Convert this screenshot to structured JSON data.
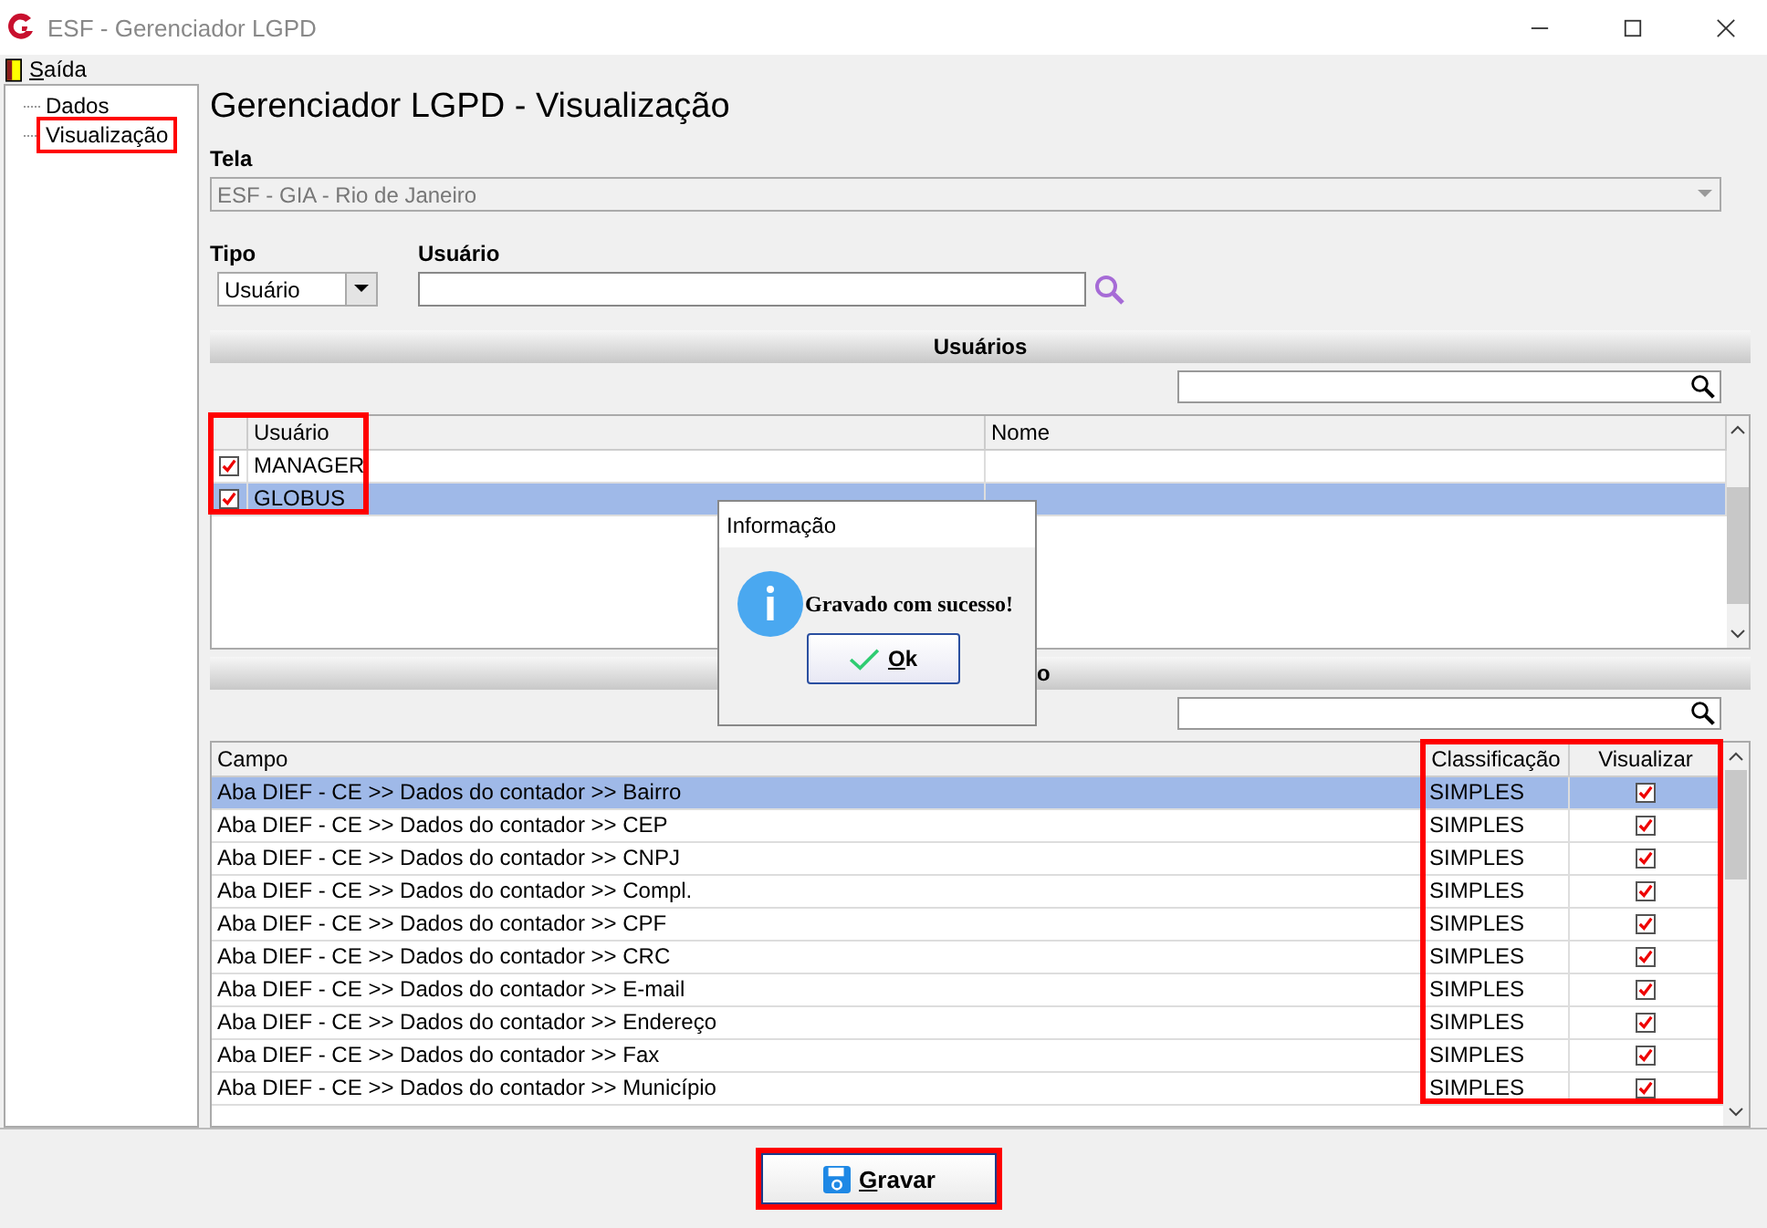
{
  "window": {
    "title": "ESF - Gerenciador LGPD"
  },
  "menu": [
    {
      "label": "Saída"
    }
  ],
  "tree": [
    {
      "label": "Dados",
      "annotated": false
    },
    {
      "label": "Visualização",
      "annotated": true
    }
  ],
  "heading": "Gerenciador LGPD - Visualização",
  "tela": {
    "label": "Tela",
    "value": "ESF - GIA - Rio de Janeiro",
    "disabled": true
  },
  "tipo": {
    "label": "Tipo",
    "value": "Usuário"
  },
  "usuario": {
    "label": "Usuário"
  },
  "users_section": {
    "title": "Usuários"
  },
  "users_table": {
    "annotated": true,
    "columns": [
      {
        "label": "Usuário"
      },
      {
        "label": "Nome"
      }
    ],
    "rows": [
      {
        "usuario": "MANAGER",
        "checked": true,
        "selected": false
      },
      {
        "usuario": "GLOBUS",
        "checked": true,
        "selected": true
      }
    ]
  },
  "fields_section": {
    "title": "o"
  },
  "fields_table": {
    "columns": [
      {
        "label": "Campo",
        "annotated": false
      },
      {
        "label": "Classificação",
        "annotated": true
      },
      {
        "label": "Visualizar",
        "annotated": true
      }
    ],
    "rows": [
      {
        "campo": "Aba DIEF - CE >> Dados do contador >> Bairro",
        "classificacao": "SIMPLES",
        "checked": true,
        "selected": true
      },
      {
        "campo": "Aba DIEF - CE >> Dados do contador >> CEP",
        "classificacao": "SIMPLES",
        "checked": true,
        "selected": false
      },
      {
        "campo": "Aba DIEF - CE >> Dados do contador >> CNPJ",
        "classificacao": "SIMPLES",
        "checked": true,
        "selected": false
      },
      {
        "campo": "Aba DIEF - CE >> Dados do contador >> Compl.",
        "classificacao": "SIMPLES",
        "checked": true,
        "selected": false
      },
      {
        "campo": "Aba DIEF - CE >> Dados do contador >> CPF",
        "classificacao": "SIMPLES",
        "checked": true,
        "selected": false
      },
      {
        "campo": "Aba DIEF - CE >> Dados do contador >> CRC",
        "classificacao": "SIMPLES",
        "checked": true,
        "selected": false
      },
      {
        "campo": "Aba DIEF - CE >> Dados do contador >> E-mail",
        "classificacao": "SIMPLES",
        "checked": true,
        "selected": false
      },
      {
        "campo": "Aba DIEF - CE >> Dados do contador >> Endereço",
        "classificacao": "SIMPLES",
        "checked": true,
        "selected": false
      },
      {
        "campo": "Aba DIEF - CE >> Dados do contador >> Fax",
        "classificacao": "SIMPLES",
        "checked": true,
        "selected": false
      },
      {
        "campo": "Aba DIEF - CE >> Dados do contador >> Município",
        "classificacao": "SIMPLES",
        "checked": true,
        "selected": false
      }
    ]
  },
  "save_button": {
    "label": "Gravar",
    "annotated": true
  },
  "dialog": {
    "title": "Informação",
    "message": "Gravado com sucesso!",
    "button": "Ok"
  }
}
